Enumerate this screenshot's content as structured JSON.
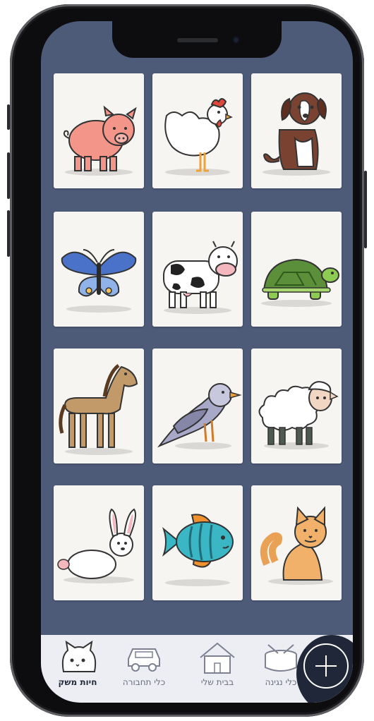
{
  "cards": [
    {
      "name": "pig-card",
      "icon": "pig-icon"
    },
    {
      "name": "rooster-card",
      "icon": "rooster-icon"
    },
    {
      "name": "dog-card",
      "icon": "dog-icon"
    },
    {
      "name": "butterfly-card",
      "icon": "butterfly-icon"
    },
    {
      "name": "cow-card",
      "icon": "cow-icon"
    },
    {
      "name": "turtle-card",
      "icon": "turtle-icon"
    },
    {
      "name": "horse-card",
      "icon": "horse-icon"
    },
    {
      "name": "bird-card",
      "icon": "bird-icon"
    },
    {
      "name": "sheep-card",
      "icon": "sheep-icon"
    },
    {
      "name": "rabbit-card",
      "icon": "rabbit-icon"
    },
    {
      "name": "fish-card",
      "icon": "fish-icon"
    },
    {
      "name": "cat-card",
      "icon": "cat-icon"
    }
  ],
  "tabs": [
    {
      "label": "חיות משק",
      "icon": "cat-face-icon",
      "active": true
    },
    {
      "label": "כלי תחבורה",
      "icon": "car-icon",
      "active": false
    },
    {
      "label": "בבית שלי",
      "icon": "house-icon",
      "active": false
    },
    {
      "label": "כלי נגינה",
      "icon": "drum-icon",
      "active": false
    }
  ],
  "add_button": {
    "icon": "plus-icon"
  },
  "colors": {
    "screen_bg": "#4d5a78",
    "card_bg": "#f6f5f1",
    "tabbar_bg": "#eceef3",
    "fab_bg": "#1f2738"
  }
}
